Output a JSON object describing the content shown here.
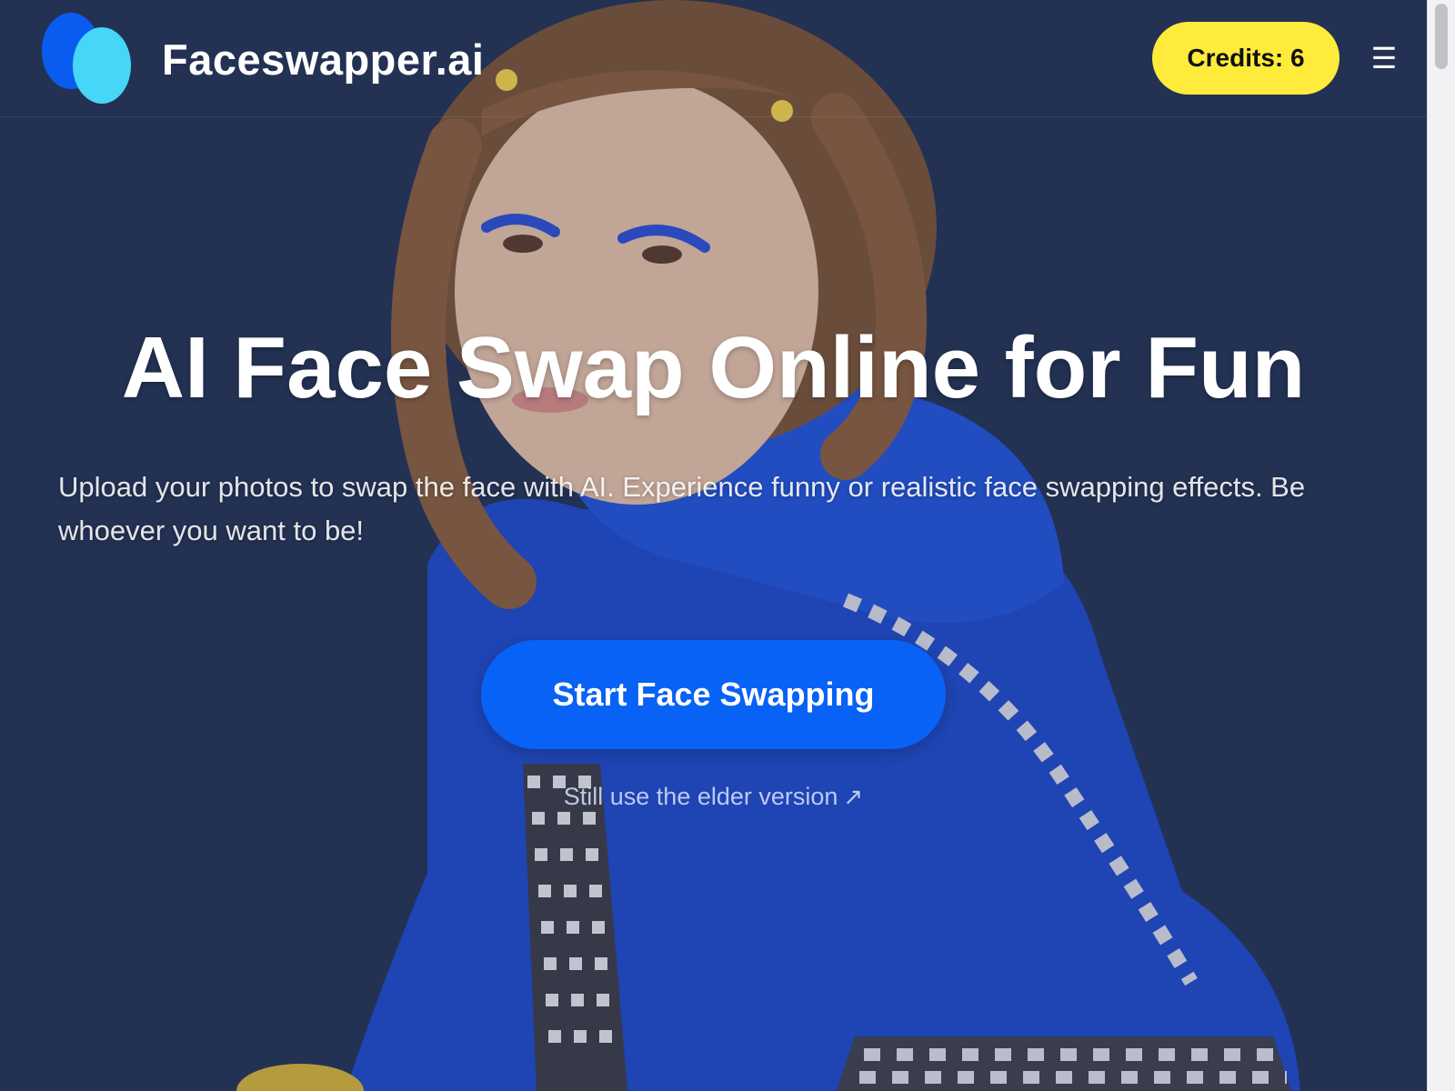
{
  "header": {
    "brand": "Faceswapper.ai",
    "logo_icon": "overlapping-ovals-logo",
    "credits_label": "Credits: 6",
    "menu_icon": "hamburger-menu-icon",
    "menu_glyph": "☰"
  },
  "hero": {
    "title": "AI Face Swap Online for Fun",
    "subtitle": "Upload your photos to swap the face with AI. Experience funny or realistic face swapping effects. Be whoever you want to be!",
    "cta_label": "Start Face Swapping",
    "elder_link": "Still use the elder version",
    "elder_arrow": "↗"
  },
  "colors": {
    "background": "#243154",
    "credits_bg": "#ffeb3b",
    "cta_bg": "#0762f5",
    "logo_dark": "#0a5cf0",
    "logo_light": "#45d6f8",
    "hoodie": "#1f48c9"
  }
}
